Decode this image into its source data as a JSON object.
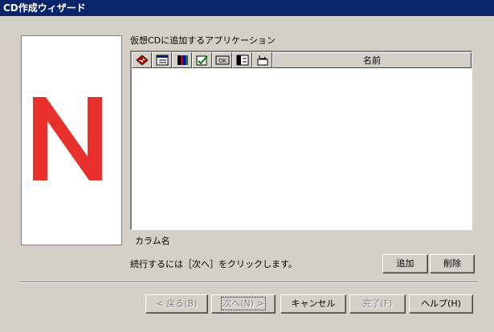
{
  "window": {
    "title": "CD作成ウィザード"
  },
  "list": {
    "label": "仮想CDに追加するアプリケーション",
    "column_name": "名前",
    "header_icons": [
      "app-diamond-icon",
      "list-details-icon",
      "color-palette-icon",
      "edit-check-icon",
      "ok-box-icon",
      "panel-window-icon",
      "export-arrow-icon"
    ]
  },
  "column_caption": "カラム名",
  "instruction": "続行するには［次へ］をクリックします。",
  "buttons": {
    "add": "追加",
    "delete": "削除",
    "back": "< 戻る(B)",
    "next": "次へ(N) >",
    "cancel": "キャンセル",
    "finish": "完了(F)",
    "help": "ヘルプ(H)"
  },
  "colors": {
    "title_bar": "#0a246a",
    "logo_red": "#e8302c",
    "dialog_bg": "#d4d0c8"
  }
}
